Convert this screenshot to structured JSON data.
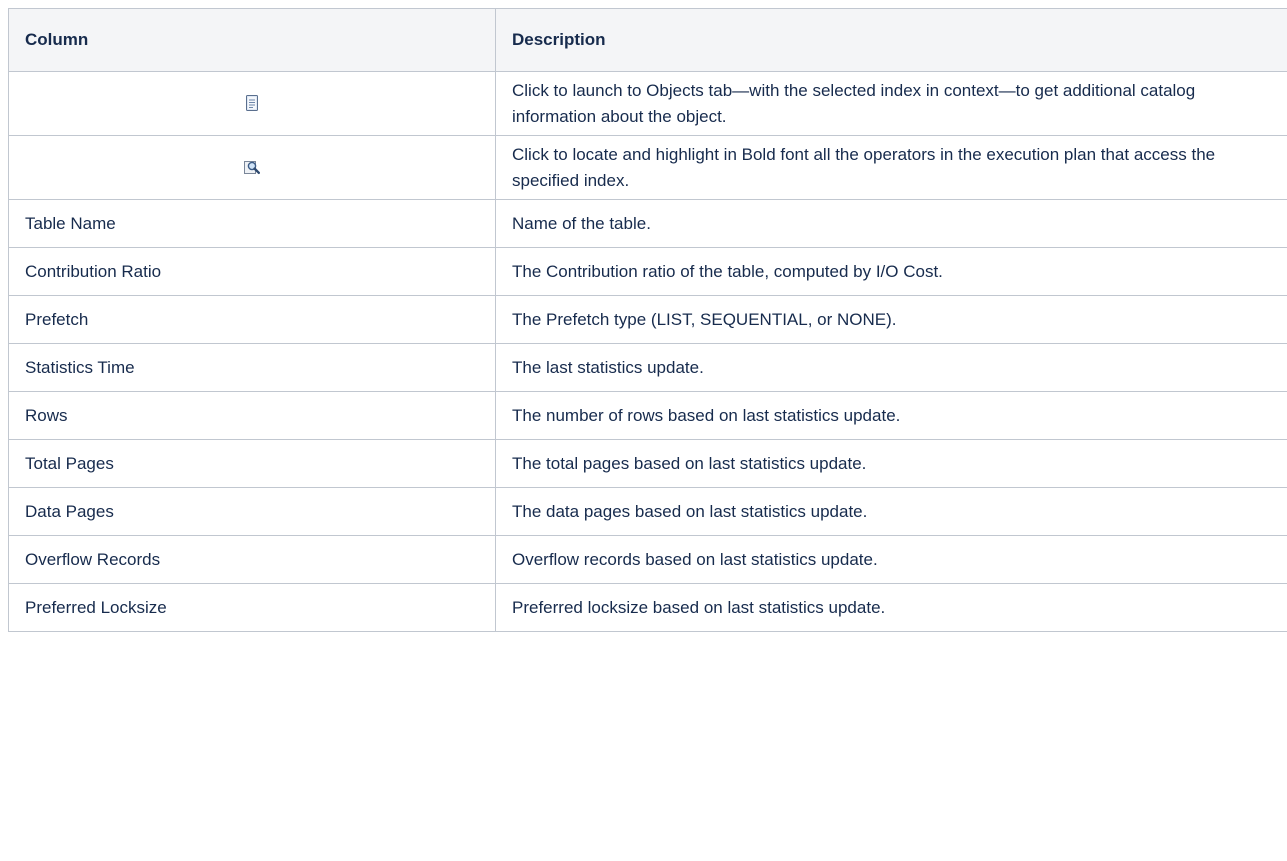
{
  "table": {
    "headers": [
      "Column",
      "Description"
    ],
    "rows": [
      {
        "column": "",
        "icon": "document-icon",
        "description": "Click to launch to Objects tab—with the selected index in context—to get additional catalog information about the object."
      },
      {
        "column": "",
        "icon": "locate-magnifier-icon",
        "description": "Click to locate and highlight in Bold font all the operators in the execution plan that access the specified index."
      },
      {
        "column": "Table Name",
        "description": "Name of the table."
      },
      {
        "column": "Contribution Ratio",
        "description": "The Contribution ratio of the table, computed by I/O Cost."
      },
      {
        "column": "Prefetch",
        "description": "The Prefetch type (LIST, SEQUENTIAL, or NONE)."
      },
      {
        "column": "Statistics Time",
        "description": "The last statistics update."
      },
      {
        "column": "Rows",
        "description": "The number of rows based on last statistics update."
      },
      {
        "column": "Total Pages",
        "description": "The total pages based on last statistics update."
      },
      {
        "column": "Data Pages",
        "description": "The data pages based on last statistics update."
      },
      {
        "column": "Overflow Records",
        "description": "Overflow records based on last statistics update."
      },
      {
        "column": "Preferred Locksize",
        "description": "Preferred locksize based on last statistics update."
      }
    ]
  }
}
